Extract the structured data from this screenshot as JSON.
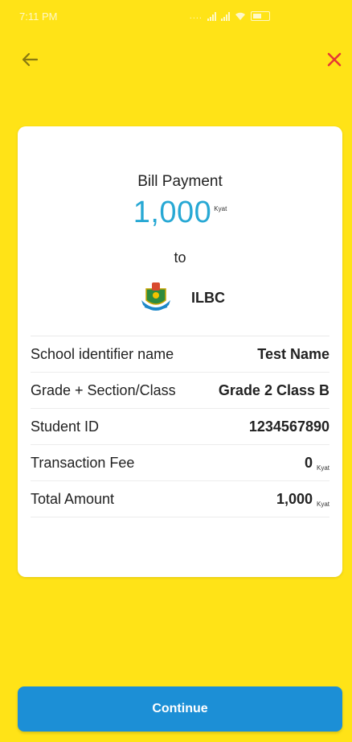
{
  "status_bar": {
    "time": "7:11 PM",
    "dots": "...."
  },
  "payment": {
    "title": "Bill Payment",
    "amount": "1,000",
    "amount_unit": "Kyat",
    "to_label": "to",
    "payee_name": "ILBC"
  },
  "details": [
    {
      "label": "School identifier name",
      "value": "Test Name",
      "unit": ""
    },
    {
      "label": "Grade + Section/Class",
      "value": "Grade 2 Class B",
      "unit": ""
    },
    {
      "label": "Student ID",
      "value": "1234567890",
      "unit": ""
    },
    {
      "label": "Transaction Fee",
      "value": "0",
      "unit": "Kyat"
    },
    {
      "label": "Total Amount",
      "value": "1,000",
      "unit": "Kyat"
    }
  ],
  "continue_label": "Continue",
  "colors": {
    "background": "#FFE317",
    "accent": "#27A8D4",
    "button": "#1C8FD6",
    "close": "#E53935"
  },
  "icons": {
    "back": "arrow-left-icon",
    "close": "close-icon",
    "logo": "school-crest-logo"
  }
}
